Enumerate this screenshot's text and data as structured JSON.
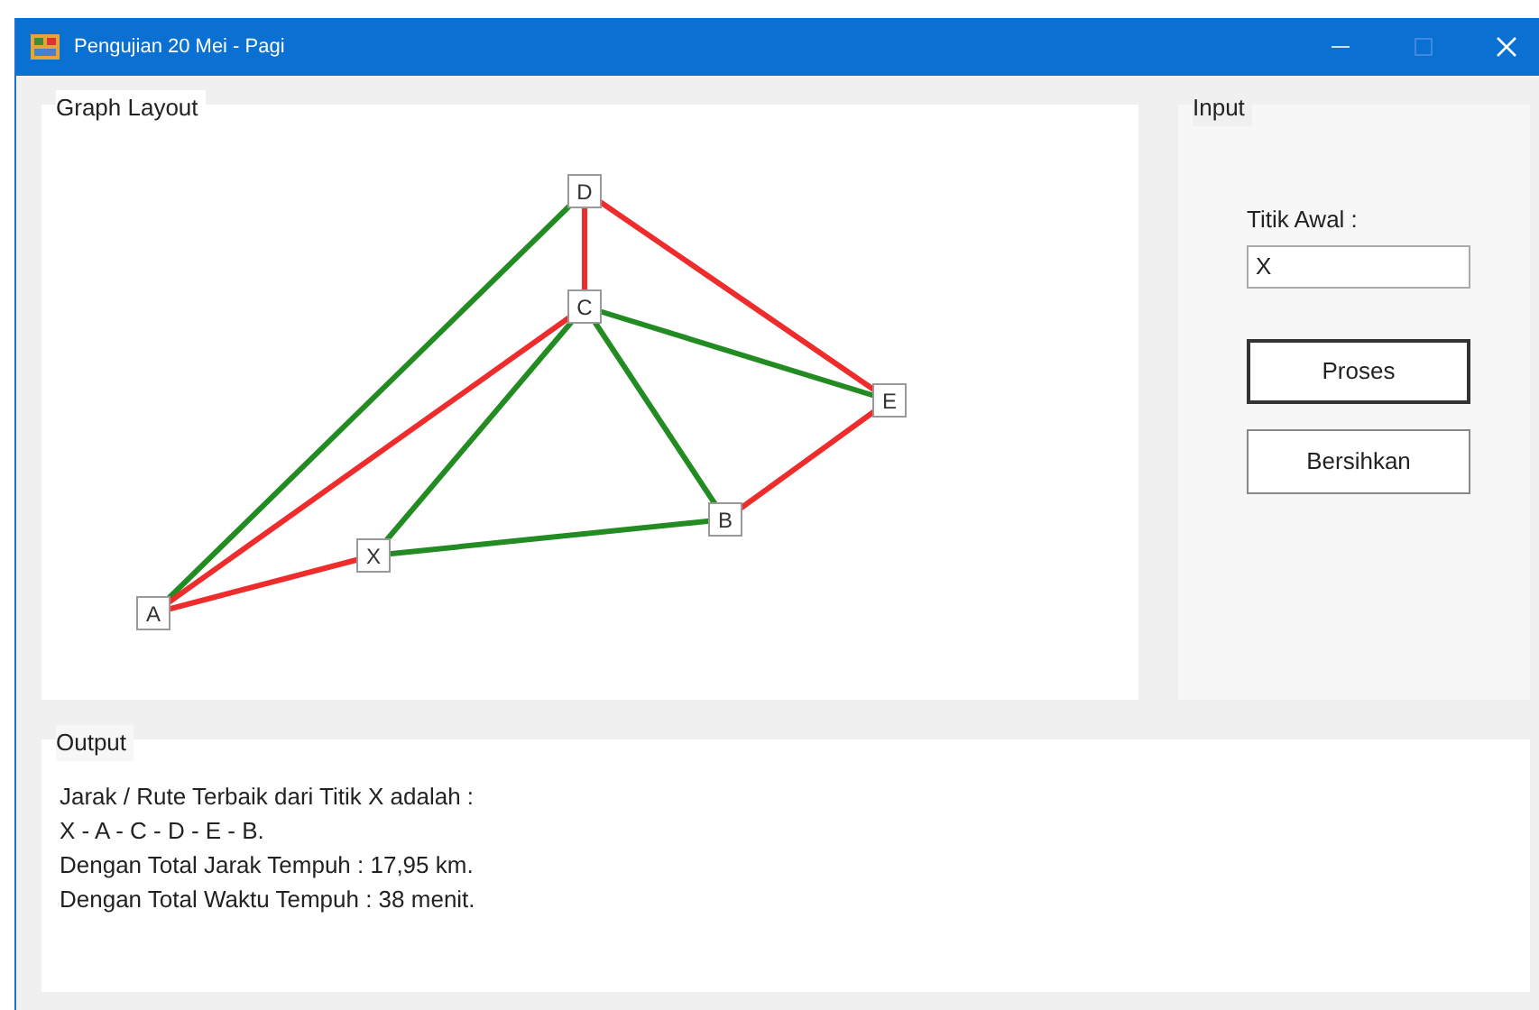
{
  "window": {
    "title": "Pengujian 20 Mei - Pagi"
  },
  "graph": {
    "title": "Graph Layout",
    "nodes": [
      {
        "label": "D"
      },
      {
        "label": "C"
      },
      {
        "label": "E"
      },
      {
        "label": "B"
      },
      {
        "label": "X"
      },
      {
        "label": "A"
      }
    ],
    "edges": [
      {
        "color": "#228b22"
      },
      {
        "color": "#ee2c2c"
      },
      {
        "color": "#ee2c2c"
      },
      {
        "color": "#228b22"
      },
      {
        "color": "#228b22"
      },
      {
        "color": "#ee2c2c"
      },
      {
        "color": "#228b22"
      },
      {
        "color": "#228b22"
      },
      {
        "color": "#ee2c2c"
      },
      {
        "color": "#ee2c2c"
      }
    ]
  },
  "input": {
    "title": "Input",
    "field_label": "Titik Awal :",
    "field_value": "X",
    "buttons": [
      {
        "label": "Proses",
        "focused": true
      },
      {
        "label": "Bersihkan",
        "focused": false
      }
    ]
  },
  "output": {
    "title": "Output",
    "lines": [
      "Jarak / Rute Terbaik dari Titik X adalah :",
      "X - A - C - D - E - B.",
      "Dengan Total Jarak Tempuh : 17,95 km.",
      "Dengan Total Waktu Tempuh : 38 menit."
    ]
  }
}
